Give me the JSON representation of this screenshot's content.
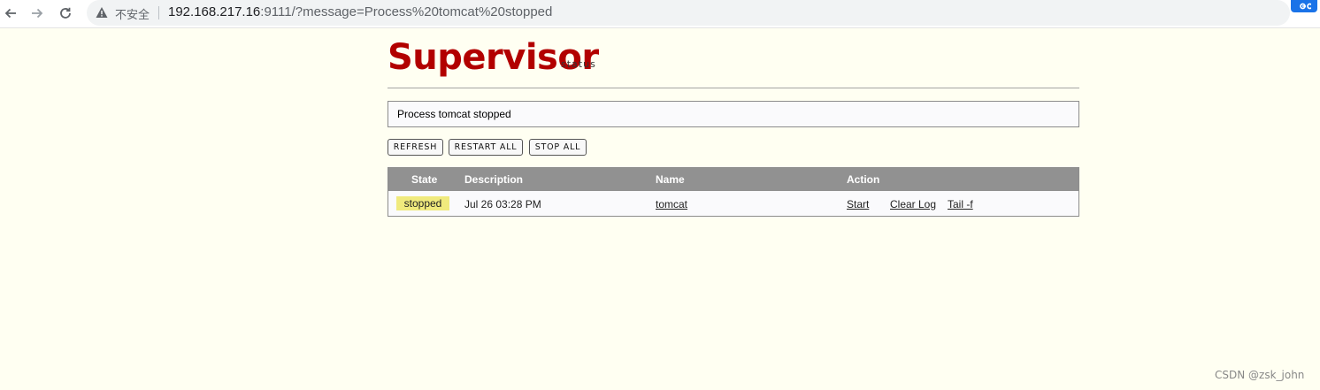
{
  "browser": {
    "security_label": "不安全",
    "url_host": "192.168.217.16",
    "url_rest": ":9111/?message=Process%20tomcat%20stopped"
  },
  "header": {
    "logo_text": "Supervisor",
    "logo_subtitle": "status",
    "logo_color": "#b20000"
  },
  "message": {
    "text": "Process tomcat stopped"
  },
  "buttons": {
    "refresh": "REFRESH",
    "restart_all": "RESTART ALL",
    "stop_all": "STOP ALL"
  },
  "table": {
    "columns": [
      "State",
      "Description",
      "Name",
      "Action"
    ],
    "rows": [
      {
        "state": "stopped",
        "description": "Jul 26 03:28 PM",
        "name": "tomcat",
        "actions": [
          "Start",
          "Clear Log",
          "Tail -f"
        ]
      }
    ]
  },
  "watermark": "CSDN @zsk_john",
  "icons": {
    "back": "back-arrow-icon",
    "forward": "forward-arrow-icon",
    "reload": "reload-icon",
    "warning": "warning-icon",
    "extension": "extension-icon"
  }
}
